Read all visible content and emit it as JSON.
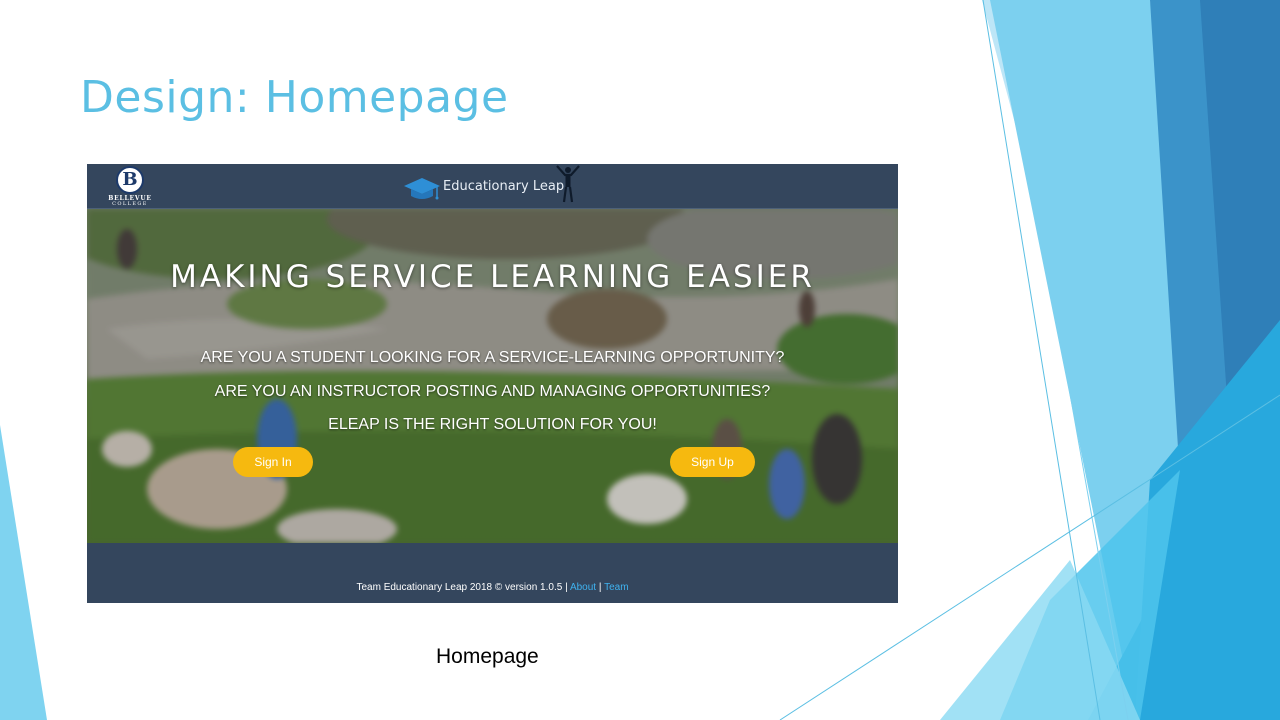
{
  "slide": {
    "title": "Design: Homepage",
    "caption": "Homepage",
    "accent_color": "#5bbfe3"
  },
  "screenshot": {
    "header": {
      "college_logo": {
        "letter": "B",
        "line1": "BELLEVUE",
        "line2": "COLLEGE"
      },
      "brand_name": "Educationary Leap",
      "brand_icons": [
        "graduation-cap-icon",
        "leaping-person-icon"
      ]
    },
    "hero": {
      "headline": "MAKING SERVICE LEARNING EASIER",
      "lines": [
        "ARE YOU A STUDENT LOOKING FOR A SERVICE-LEARNING OPPORTUNITY?",
        "ARE YOU AN INSTRUCTOR POSTING AND MANAGING OPPORTUNITIES?",
        "ELEAP IS THE RIGHT SOLUTION FOR YOU!"
      ],
      "sign_in_label": "Sign In",
      "sign_up_label": "Sign Up",
      "button_color": "#f6b90f"
    },
    "footer": {
      "text": "Team Educationary Leap 2018 © version 1.0.5",
      "separator": "|",
      "about_link": "About",
      "team_link": "Team",
      "link_color": "#3fb2ef"
    },
    "header_color": "#34465d"
  }
}
